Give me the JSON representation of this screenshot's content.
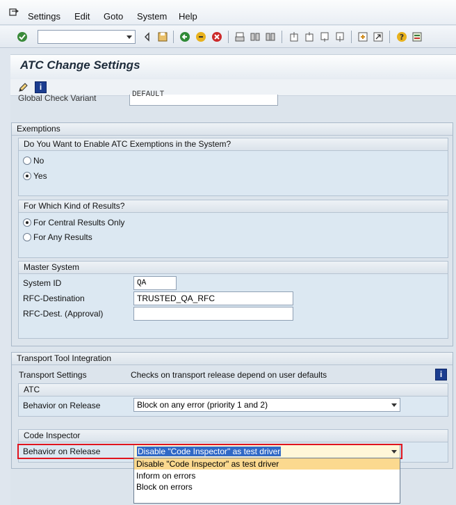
{
  "menu": [
    "Settings",
    "Edit",
    "Goto",
    "System",
    "Help"
  ],
  "toolbar": {
    "icons": [
      "enter-check-icon",
      "back-icon",
      "save-icon",
      "nav-back-icon",
      "exit-icon",
      "cancel-icon",
      "print-icon",
      "find-icon",
      "find-next-icon",
      "first-page-icon",
      "prev-page-icon",
      "next-page-icon",
      "last-page-icon",
      "new-session-icon",
      "shortcut-icon",
      "help-icon",
      "layout-icon"
    ]
  },
  "title": "ATC Change Settings",
  "partial": {
    "label": "Global Check Variant",
    "value": "DEFAULT"
  },
  "exemptions": {
    "header": "Exemptions",
    "enable_group": {
      "header": "Do You Want to Enable ATC Exemptions in the System?",
      "options": [
        {
          "label": "No",
          "selected": false
        },
        {
          "label": "Yes",
          "selected": true
        }
      ]
    },
    "results_group": {
      "header": "For Which Kind of Results?",
      "options": [
        {
          "label": "For Central Results Only",
          "selected": true
        },
        {
          "label": "For Any Results",
          "selected": false
        }
      ]
    },
    "master_group": {
      "header": "Master System",
      "system_id_label": "System ID",
      "system_id_value": "QA",
      "rfc_label": "RFC-Destination",
      "rfc_value": "TRUSTED_QA_RFC",
      "rfc_approval_label": "RFC-Dest. (Approval)",
      "rfc_approval_value": ""
    }
  },
  "transport": {
    "header": "Transport Tool Integration",
    "settings_label": "Transport Settings",
    "settings_value": "Checks on transport release depend on user defaults",
    "atc": {
      "header": "ATC",
      "behavior_label": "Behavior on Release",
      "behavior_value": "Block on any error (priority 1 and 2)"
    },
    "code_inspector": {
      "header": "Code Inspector",
      "behavior_label": "Behavior on Release",
      "behavior_value": "Disable \"Code Inspector\" as test driver",
      "options": [
        "Disable \"Code Inspector\" as test driver",
        "Inform on errors",
        "Block on errors"
      ]
    }
  },
  "colors": {
    "highlight_border": "#e0141e",
    "selected_option_bg": "#fbd98f",
    "text_selection_bg": "#3169c6"
  }
}
